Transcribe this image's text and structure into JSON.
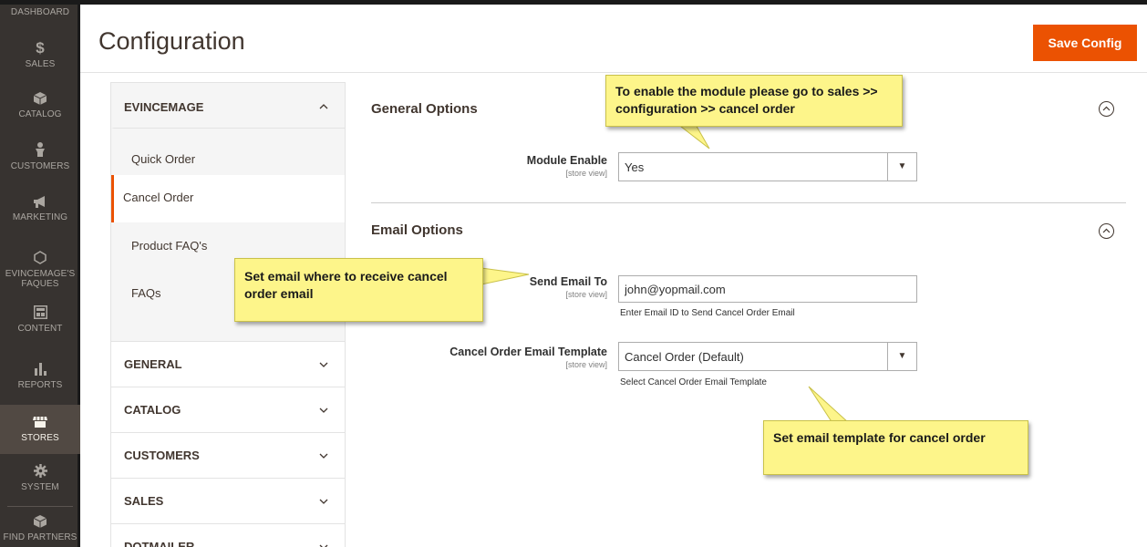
{
  "nav": {
    "items": [
      {
        "label": "DASHBOARD",
        "icon": "dashboard-icon"
      },
      {
        "label": "SALES",
        "icon": "dollar-icon"
      },
      {
        "label": "CATALOG",
        "icon": "box-icon"
      },
      {
        "label": "CUSTOMERS",
        "icon": "person-icon"
      },
      {
        "label": "MARKETING",
        "icon": "megaphone-icon"
      },
      {
        "label": "EVINCEMAGE'S FAQUES",
        "icon": "hexagon-icon"
      },
      {
        "label": "CONTENT",
        "icon": "layout-icon"
      },
      {
        "label": "REPORTS",
        "icon": "bar-chart-icon"
      },
      {
        "label": "STORES",
        "icon": "store-icon"
      },
      {
        "label": "SYSTEM",
        "icon": "gear-icon"
      },
      {
        "label": "FIND PARTNERS",
        "icon": "partners-box-icon"
      }
    ],
    "sales_symbol": "$"
  },
  "header": {
    "title": "Configuration",
    "save_label": "Save Config"
  },
  "tabs": {
    "evincemage": {
      "label": "EVINCEMAGE",
      "items": [
        "Quick Order",
        "Cancel Order",
        "Product FAQ's",
        "FAQs"
      ]
    },
    "groups": [
      "GENERAL",
      "CATALOG",
      "CUSTOMERS",
      "SALES",
      "DOTMAILER"
    ]
  },
  "general_options": {
    "title": "General Options",
    "module_enable": {
      "label": "Module Enable",
      "scope": "[store view]",
      "value": "Yes"
    }
  },
  "email_options": {
    "title": "Email Options",
    "send_email_to": {
      "label": "Send Email To",
      "scope": "[store view]",
      "value": "john@yopmail.com",
      "note": "Enter Email ID to Send Cancel Order Email"
    },
    "template": {
      "label": "Cancel Order Email Template",
      "scope": "[store view]",
      "value": "Cancel Order (Default)",
      "note": "Select Cancel Order Email Template"
    }
  },
  "callouts": {
    "module": "To enable the module please go to sales >> configuration >> cancel order",
    "email": "Set email where to receive cancel order email",
    "template": "Set email template for cancel order"
  },
  "colors": {
    "accent": "#eb5202",
    "nav_bg": "#373330",
    "callout": "#fdf58a"
  }
}
